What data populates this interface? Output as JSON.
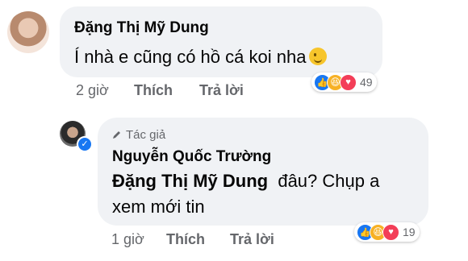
{
  "comment1": {
    "author": "Đặng Thị Mỹ Dung",
    "text": "Í nhà e cũng có hồ cá koi nha",
    "emoji_icon": "winking-face-emoji",
    "time": "2 giờ",
    "like_label": "Thích",
    "reply_label": "Trả lời",
    "reactions": [
      "like",
      "haha",
      "love"
    ],
    "reaction_count": "49"
  },
  "comment2": {
    "author_badge": "Tác giả",
    "author": "Nguyễn Quốc Trường",
    "mention": "Đặng Thị Mỹ Dung",
    "text_after_mention": "đâu? Chụp a",
    "text_line2": "xem mới tin",
    "time": "1 giờ",
    "like_label": "Thích",
    "reply_label": "Trả lời",
    "reactions": [
      "like",
      "haha",
      "love"
    ],
    "reaction_count": "19"
  },
  "colors": {
    "like": "#1877f2",
    "haha": "#f7b125",
    "love": "#f33e58",
    "bubble": "#f0f2f5",
    "meta": "#65676b"
  }
}
